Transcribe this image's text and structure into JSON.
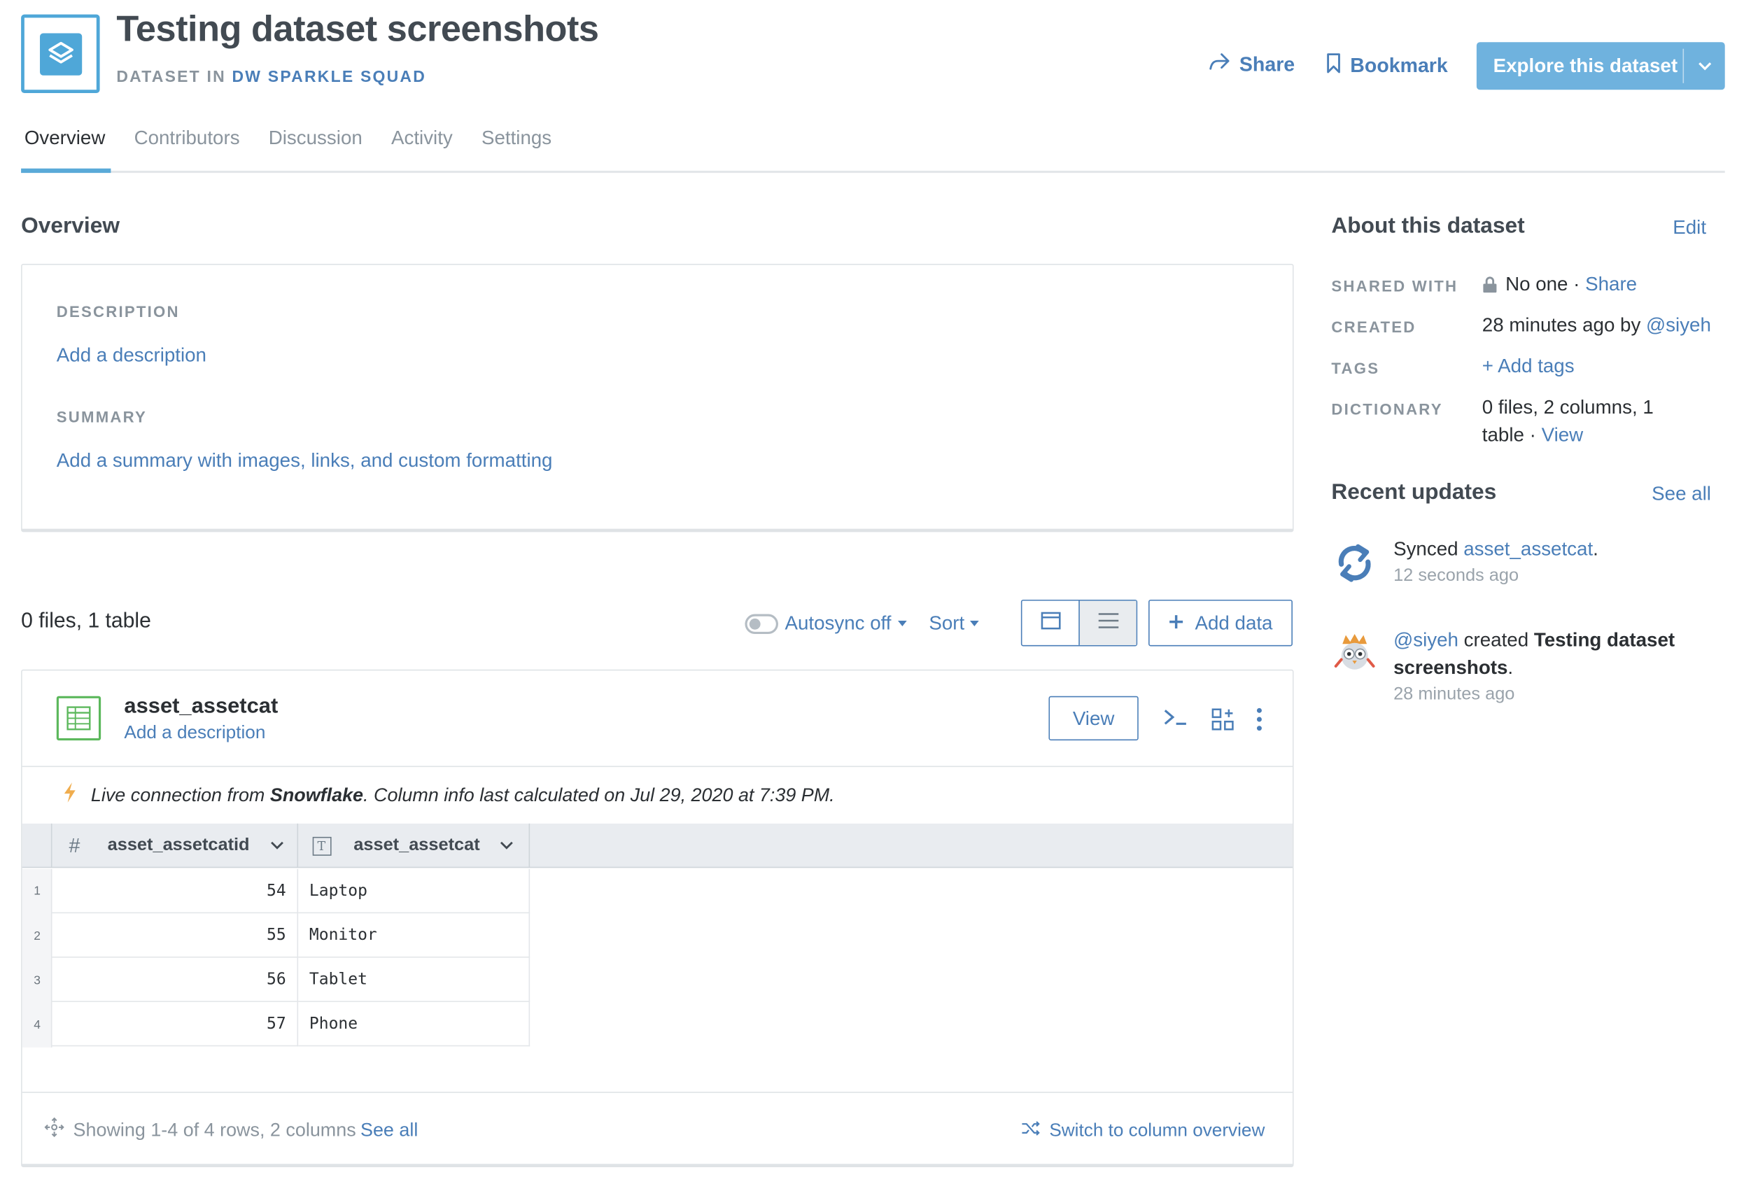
{
  "header": {
    "title": "Testing dataset screenshots",
    "subtitle_prefix": "DATASET IN ",
    "org": "DW SPARKLE SQUAD",
    "share_label": "Share",
    "bookmark_label": "Bookmark",
    "explore_label": "Explore this dataset"
  },
  "tabs": [
    {
      "label": "Overview",
      "active": true
    },
    {
      "label": "Contributors",
      "active": false
    },
    {
      "label": "Discussion",
      "active": false
    },
    {
      "label": "Activity",
      "active": false
    },
    {
      "label": "Settings",
      "active": false
    }
  ],
  "overview": {
    "heading": "Overview",
    "description_label": "DESCRIPTION",
    "description_link": "Add a description",
    "summary_label": "SUMMARY",
    "summary_link": "Add a summary with images, links, and custom formatting"
  },
  "files": {
    "count_text": "0 files, 1 table",
    "autosync_label": "Autosync off",
    "sort_label": "Sort",
    "add_data_label": "Add data"
  },
  "table_card": {
    "name": "asset_assetcat",
    "description_link": "Add a description",
    "view_label": "View",
    "live_prefix": "Live connection from ",
    "live_source": "Snowflake",
    "live_suffix": ". Column info last calculated on Jul 29, 2020 at 7:39 PM.",
    "columns": [
      {
        "type_icon": "#",
        "name": "asset_assetcatid"
      },
      {
        "type_icon": "T",
        "name": "asset_assetcat"
      }
    ],
    "rows": [
      {
        "n": "1",
        "id": "54",
        "cat": "Laptop"
      },
      {
        "n": "2",
        "id": "55",
        "cat": "Monitor"
      },
      {
        "n": "3",
        "id": "56",
        "cat": "Tablet"
      },
      {
        "n": "4",
        "id": "57",
        "cat": "Phone"
      }
    ],
    "showing_text": "Showing 1-4 of 4 rows, 2 columns",
    "see_all": "See all",
    "switch_label": "Switch to column overview"
  },
  "about": {
    "heading": "About this dataset",
    "edit_label": "Edit",
    "shared_with_label": "SHARED WITH",
    "shared_with_value": "No one",
    "shared_with_dot": " · ",
    "shared_with_link": "Share",
    "created_label": "CREATED",
    "created_value": "28 minutes ago by ",
    "created_user": "@siyeh",
    "tags_label": "TAGS",
    "tags_link": "+ Add tags",
    "dictionary_label": "DICTIONARY",
    "dictionary_value": "0 files, 2 columns, 1 table",
    "dictionary_dot": " · ",
    "dictionary_link": "View"
  },
  "recent": {
    "heading": "Recent updates",
    "see_all": "See all",
    "items": [
      {
        "prefix": "Synced ",
        "link": "asset_assetcat",
        "suffix": ".",
        "time": "12 seconds ago"
      },
      {
        "user": "@siyeh",
        "verb": " created ",
        "object": "Testing dataset screenshots",
        "suffix": ".",
        "time": "28 minutes ago"
      }
    ]
  },
  "colors": {
    "accent": "#4a7eb8",
    "primary_button": "#6fb2de",
    "logo": "#4fa7d8",
    "table_icon": "#5cb85c",
    "lightning": "#f0ad4e"
  }
}
